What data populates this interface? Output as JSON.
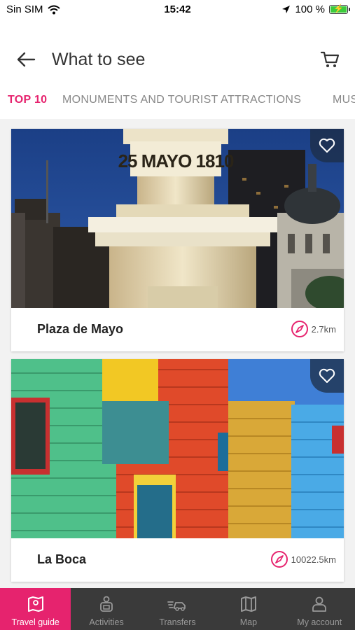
{
  "status": {
    "carrier": "Sin SIM",
    "time": "15:42",
    "battery": "100 %",
    "battery_level": 1.0
  },
  "header": {
    "title": "What to see"
  },
  "tabs": [
    {
      "label": "TOP 10",
      "active": true
    },
    {
      "label": "MONUMENTS AND TOURIST ATTRACTIONS",
      "active": false
    },
    {
      "label": "MUS",
      "active": false
    }
  ],
  "cards": [
    {
      "title": "Plaza de Mayo",
      "distance": "2.7km",
      "image_text": "25 MAYO 1810"
    },
    {
      "title": "La Boca",
      "distance": "10022.5km"
    }
  ],
  "nav": [
    {
      "label": "Travel guide",
      "icon": "map-book-icon",
      "active": true
    },
    {
      "label": "Activities",
      "icon": "activities-icon",
      "active": false
    },
    {
      "label": "Transfers",
      "icon": "transfer-car-icon",
      "active": false
    },
    {
      "label": "Map",
      "icon": "map-icon",
      "active": false
    },
    {
      "label": "My account",
      "icon": "user-icon",
      "active": false
    }
  ],
  "colors": {
    "accent": "#e6236e",
    "nav_bg": "#3a3a3a"
  }
}
